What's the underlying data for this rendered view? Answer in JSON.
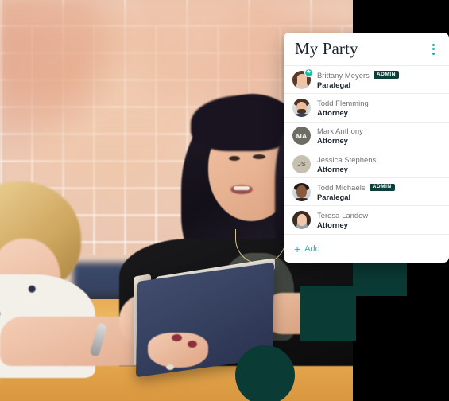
{
  "card": {
    "title": "My Party",
    "menu_icon": "kebab-menu-icon",
    "members": [
      {
        "name": "Brittany Meyers",
        "role": "Paralegal",
        "badge": "ADMIN",
        "avatar_type": "photo",
        "avatar_initials": "",
        "star": "★"
      },
      {
        "name": "Todd Flemming",
        "role": "Attorney",
        "badge": "",
        "avatar_type": "photo",
        "avatar_initials": "",
        "star": ""
      },
      {
        "name": "Mark Anthony",
        "role": "Attorney",
        "badge": "",
        "avatar_type": "initials",
        "avatar_initials": "MA",
        "star": ""
      },
      {
        "name": "Jessica Stephens",
        "role": "Attorney",
        "badge": "",
        "avatar_type": "initials",
        "avatar_initials": "JS",
        "star": ""
      },
      {
        "name": "Todd Michaels",
        "role": "Paralegal",
        "badge": "ADMIN",
        "avatar_type": "photo",
        "avatar_initials": "",
        "star": ""
      },
      {
        "name": "Teresa Landow",
        "role": "Attorney",
        "badge": "",
        "avatar_type": "photo",
        "avatar_initials": "",
        "star": ""
      }
    ],
    "add_label": "Add",
    "add_plus": "+"
  },
  "colors": {
    "accent_teal": "#26bdae",
    "badge_dark_green": "#0d3f3a",
    "shape_dark_green": "#0b3b35",
    "title_text": "#1b2430",
    "name_text": "#6e7275",
    "card_background": "#ffffff",
    "page_background": "#000000"
  },
  "photo": {
    "description": "Two women seated at a wooden table in front of a brick wall, one holding a tablet"
  },
  "decor": {
    "square_upper": "dark-green-square",
    "square_lower": "dark-green-square",
    "circle": "dark-green-circle"
  }
}
